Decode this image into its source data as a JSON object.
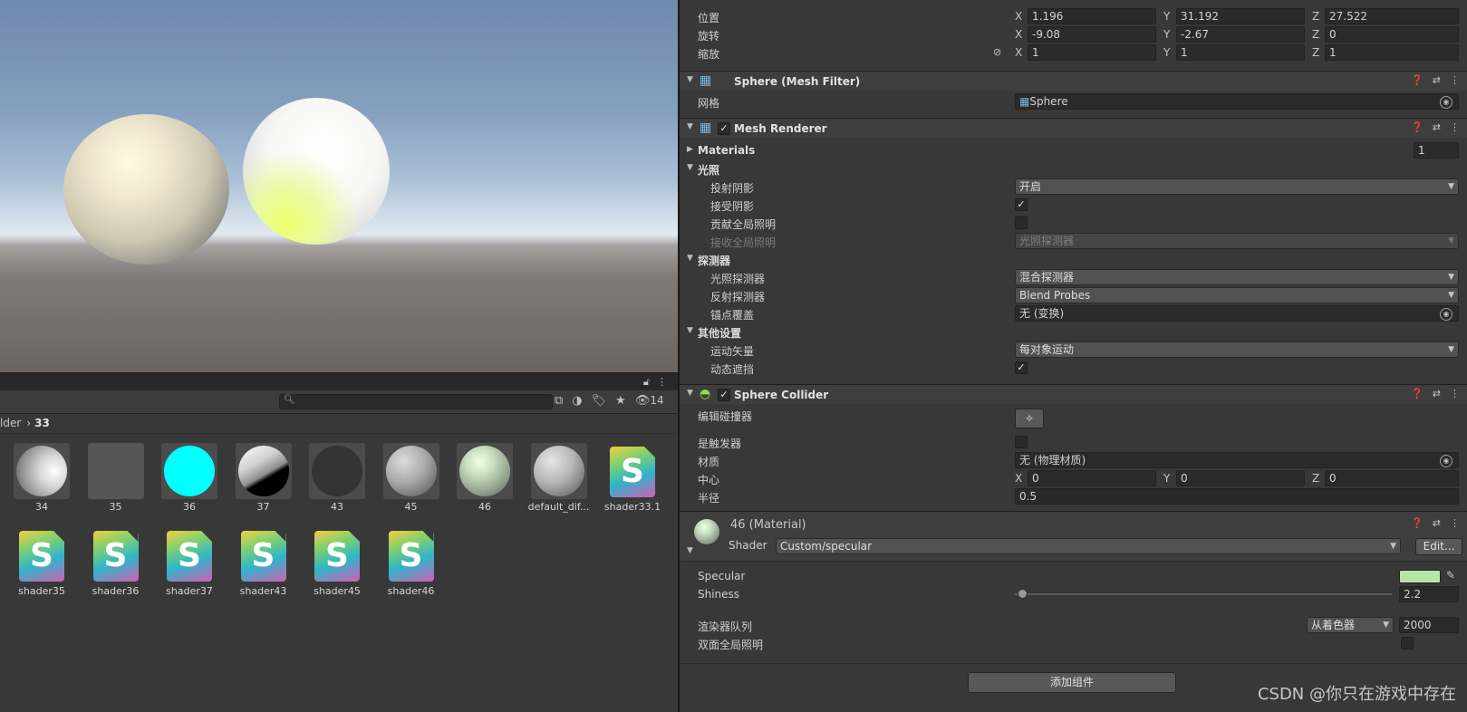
{
  "project": {
    "hidden_count": "14",
    "breadcrumb_prev": "lder",
    "breadcrumb_sep": "›",
    "breadcrumb_current": "33",
    "assets": [
      {
        "name": "34",
        "kind": "material",
        "ball": "radial-gradient(circle at 75% 50%, #ffffff 0%, #d4d4d4 35%, #8a8a8a 75%, #4a4a4a 100%)"
      },
      {
        "name": "35",
        "kind": "flat",
        "ball": "#555555"
      },
      {
        "name": "36",
        "kind": "material",
        "ball": "#00ffff"
      },
      {
        "name": "37",
        "kind": "material",
        "ball": "linear-gradient(150deg, #ffffff 0%, #d0d0d0 35%, #8d8d8d 55%, #000000 62%, #000000 100%)"
      },
      {
        "name": "43",
        "kind": "material",
        "ball": "#333333"
      },
      {
        "name": "45",
        "kind": "material",
        "ball": "radial-gradient(circle at 35% 30%, #dcdcdc 0%, #aaaaaa 45%, #6e6e6e 80%, #4a4a4a 100%)"
      },
      {
        "name": "46",
        "kind": "material",
        "ball": "radial-gradient(circle at 40% 32%, #f2ffe8 0%, #c9dfbd 30%, #8a9a86 70%, #4d534d 100%)"
      },
      {
        "name": "default_dif...",
        "kind": "material",
        "ball": "radial-gradient(circle at 35% 30%, #e6e6e6 0%, #b5b5b5 45%, #777777 80%, #4e4e4e 100%)"
      },
      {
        "name": "shader33.1",
        "kind": "shader"
      },
      {
        "name": "shader35",
        "kind": "shader"
      },
      {
        "name": "shader36",
        "kind": "shader"
      },
      {
        "name": "shader37",
        "kind": "shader"
      },
      {
        "name": "shader43",
        "kind": "shader"
      },
      {
        "name": "shader45",
        "kind": "shader"
      },
      {
        "name": "shader46",
        "kind": "shader"
      }
    ],
    "shader_letter": "S"
  },
  "transform": {
    "position_label": "位置",
    "rotation_label": "旋转",
    "scale_label": "缩放",
    "position": {
      "x": "1.196",
      "y": "31.192",
      "z": "27.522"
    },
    "rotation": {
      "x": "-9.08",
      "y": "-2.67",
      "z": "0"
    },
    "scale": {
      "x": "1",
      "y": "1",
      "z": "1"
    },
    "axis_x": "X",
    "axis_y": "Y",
    "axis_z": "Z"
  },
  "mesh_filter": {
    "title": "Sphere (Mesh Filter)",
    "mesh_label": "网格",
    "mesh_value": "Sphere"
  },
  "mesh_renderer": {
    "title": "Mesh Renderer",
    "materials_label": "Materials",
    "materials_count": "1",
    "lighting_label": "光照",
    "cast_shadows_label": "投射阴影",
    "cast_shadows_value": "开启",
    "receive_shadows_label": "接受阴影",
    "contribute_gi_label": "贡献全局照明",
    "receive_gi_label": "接收全局照明",
    "receive_gi_value": "光照探测器",
    "probes_label": "探测器",
    "light_probes_label": "光照探测器",
    "light_probes_value": "混合探测器",
    "reflection_probes_label": "反射探测器",
    "reflection_probes_value": "Blend Probes",
    "anchor_label": "锚点覆盖",
    "anchor_value": "无 (变换)",
    "additional_label": "其他设置",
    "motion_vectors_label": "运动矢量",
    "motion_vectors_value": "每对象运动",
    "dynamic_occlusion_label": "动态遮挡"
  },
  "sphere_collider": {
    "title": "Sphere Collider",
    "edit_label": "编辑碰撞器",
    "is_trigger_label": "是触发器",
    "material_label": "材质",
    "material_value": "无 (物理材质)",
    "center_label": "中心",
    "center": {
      "x": "0",
      "y": "0",
      "z": "0"
    },
    "radius_label": "半径",
    "radius_value": "0.5"
  },
  "material": {
    "title": "46 (Material)",
    "shader_label": "Shader",
    "shader_value": "Custom/specular",
    "edit_button": "Edit...",
    "specular_label": "Specular",
    "specular_color": "#b6e6a3",
    "shiness_label": "Shiness",
    "shiness_value": "2.2",
    "shiness_fraction": 0.02,
    "render_queue_label": "渲染器队列",
    "render_queue_mode": "从着色器",
    "render_queue_value": "2000",
    "double_sided_gi_label": "双面全局照明"
  },
  "add_component_label": "添加组件",
  "watermark": "CSDN @你只在游戏中存在",
  "check_mark": "✓"
}
